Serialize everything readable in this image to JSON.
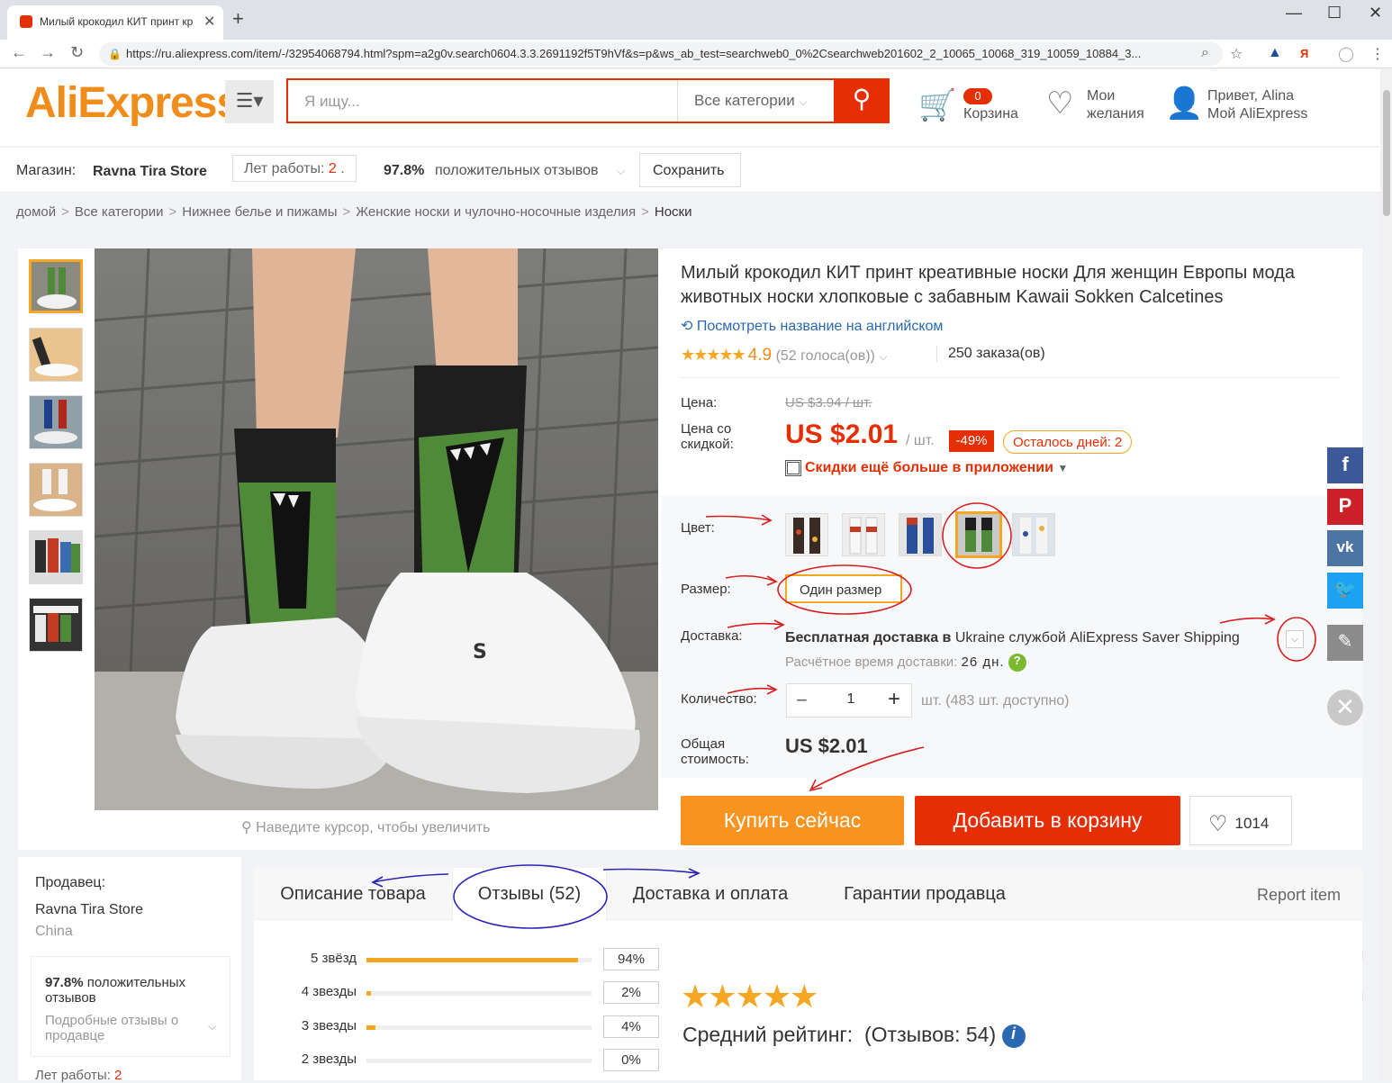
{
  "browser": {
    "tab_title": "Милый крокодил КИТ принт кр",
    "tab_close": "✕",
    "new_tab": "+",
    "url": "https://ru.aliexpress.com/item/-/32954068794.html?spm=a2g0v.search0604.3.3.2691192f5T9hVf&s=p&ws_ab_test=searchweb0_0%2Csearchweb201602_2_10065_10068_319_10059_10884_3...",
    "win_min": "—",
    "win_max": "☐",
    "win_close": "✕"
  },
  "header": {
    "logo_main": "AliExpress",
    "logo_tm": "™",
    "search_placeholder": "Я ищу...",
    "search_category": "Все категории",
    "cart_count": "0",
    "cart_label": "Корзина",
    "wishlist_line1": "Мои",
    "wishlist_line2": "желания",
    "account_line1": "Привет, Alina",
    "account_line2": "Мой AliExpress"
  },
  "store": {
    "label": "Магазин:",
    "name": "Ravna Tira Store",
    "years_label": "Лет работы:",
    "years_value": "2",
    "positive_pct": "97.8%",
    "positive_label": "положительных отзывов",
    "save_label": "Сохранить"
  },
  "breadcrumb": [
    "домой",
    "Все категории",
    "Нижнее белье и пижамы",
    "Женские носки и чулочно-носочные изделия",
    "Носки"
  ],
  "product": {
    "title": "Милый крокодил КИТ принт креативные носки Для женщин Европы мода животных носки хлопковые с забавным Kawaii Sokken Calcetines",
    "english_link": "Посмотреть название на английском",
    "rating_value": "4.9",
    "votes": "(52 голоса(ов))",
    "orders": "250 заказа(ов)",
    "price_label": "Цена:",
    "old_price": "US $3.94 / шт.",
    "discount_price_label": "Цена со скидкой:",
    "price": "US $2.01",
    "unit": "/ шт.",
    "discount": "-49%",
    "days_left": "Осталось дней: 2",
    "app_discount": "Скидки ещё больше в приложении",
    "color_label": "Цвет:",
    "size_label": "Размер:",
    "size_value": "Один размер",
    "delivery_label": "Доставка:",
    "delivery_bold": "Бесплатная доставка в",
    "delivery_rest": "Ukraine службой AliExpress Saver Shipping",
    "delivery_time_label": "Расчётное время доставки:",
    "delivery_time": "26 дн.",
    "qty_label": "Количество:",
    "qty_value": "1",
    "qty_available": "шт. (483 шт. доступно)",
    "total_label": "Общая стоимость:",
    "total": "US $2.01",
    "buy_now": "Купить сейчас",
    "add_to_cart": "Добавить в корзину",
    "wish_count": "1014",
    "zoom_hint": "Наведите курсор, чтобы увеличить"
  },
  "seller": {
    "label": "Продавец:",
    "name": "Ravna Tira Store",
    "country": "China",
    "positive_pct": "97.8%",
    "positive_label": "положительных отзывов",
    "detailed": "Подробные отзывы о продавце",
    "years_label": "Лет работы:",
    "years_value": "2"
  },
  "tabs": [
    {
      "label": "Описание товара"
    },
    {
      "label": "Отзывы (52)"
    },
    {
      "label": "Доставка и оплата"
    },
    {
      "label": "Гарантии продавца"
    }
  ],
  "report": "Report item",
  "reviews": {
    "rows": [
      {
        "label": "5 звёзд",
        "pct": "94%",
        "fraction": 0.94
      },
      {
        "label": "4 звезды",
        "pct": "2%",
        "fraction": 0.02
      },
      {
        "label": "3 звезды",
        "pct": "4%",
        "fraction": 0.04
      },
      {
        "label": "2 звезды",
        "pct": "0%",
        "fraction": 0
      }
    ],
    "avg_label": "Средний рейтинг:",
    "count": "(Отзывов: 54)"
  },
  "colors": {
    "accent": "#e62e04",
    "orange": "#f7931e",
    "star": "#f5a623",
    "link": "#2a69b2"
  }
}
